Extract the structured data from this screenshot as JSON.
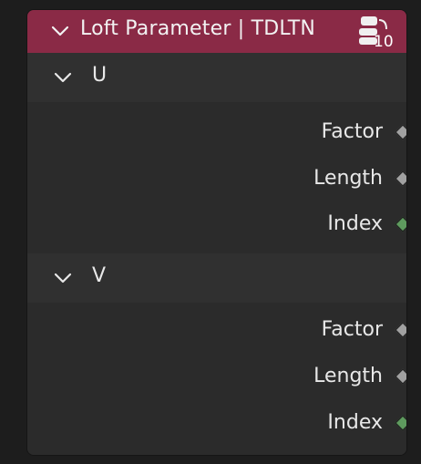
{
  "node": {
    "title": "Loft Parameter | TDLTN",
    "badge_count": "10",
    "header_color": "#8a2a46"
  },
  "panels": [
    {
      "label": "U",
      "outputs": [
        {
          "label": "Factor",
          "socket_color": "#a1a1a1"
        },
        {
          "label": "Length",
          "socket_color": "#a1a1a1"
        },
        {
          "label": "Index",
          "socket_color": "#5e9a5e"
        }
      ]
    },
    {
      "label": "V",
      "outputs": [
        {
          "label": "Factor",
          "socket_color": "#a1a1a1"
        },
        {
          "label": "Length",
          "socket_color": "#a1a1a1"
        },
        {
          "label": "Index",
          "socket_color": "#5e9a5e"
        }
      ]
    }
  ],
  "icons": {
    "header_collapse": "chevron-down-icon",
    "badge": "node-group-icon",
    "panel_collapse": "chevron-down-icon",
    "socket": "diamond-socket-icon"
  }
}
